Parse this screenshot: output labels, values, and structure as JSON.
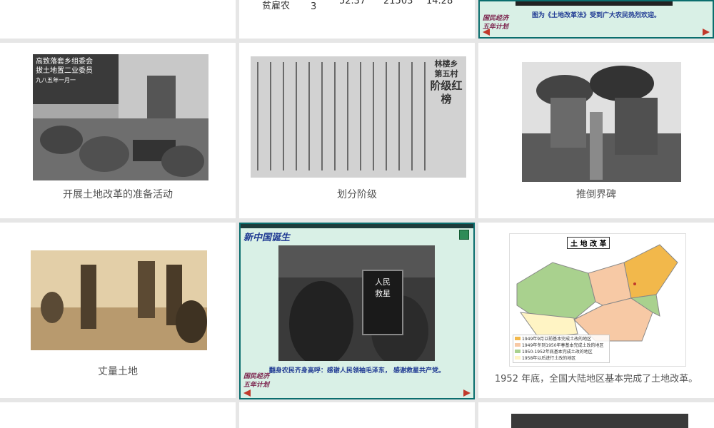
{
  "row0": {
    "table": {
      "label": "贫雇农",
      "sub": "3",
      "c1": "52.37",
      "c2": "21503",
      "c3": "14.28"
    },
    "slide_caption": "图为《土地改革法》受到广大农民热烈欢迎。",
    "nav": [
      "国民经济",
      "五年计划"
    ]
  },
  "row1": [
    {
      "caption": "开展土地改革的准备活动",
      "sign": [
        "高致落套乡组委会",
        "拔土地置二业委员",
        "九八五年一月一"
      ]
    },
    {
      "caption": "划分阶级",
      "banner": [
        "林楼乡",
        "第五村",
        "阶级红榜"
      ]
    },
    {
      "caption": "推倒界碑"
    }
  ],
  "row2": [
    {
      "caption": "丈量土地"
    },
    {
      "title": "新中国诞生",
      "note": "翻身农民齐身高呼：感谢人民领袖毛泽东， 感谢救星共产党。",
      "placard": "人民救星",
      "nav": [
        "国民经济",
        "五年计划"
      ]
    },
    {
      "caption": "1952 年底，全国大陆地区基本完成了土地改革。",
      "map_title": "土 地 改 革",
      "legend": [
        "1949年9月以前基本完成土改的地区",
        "1949年冬到1950年春基本完成土改的地区",
        "1950-1952年底基本完成土改的地区",
        "1958年以后进行土改的地区"
      ],
      "colors": {
        "old": "#f2b84b",
        "early": "#f7c9a5",
        "mid": "#a9d18e",
        "late": "#fff4c4"
      }
    }
  ]
}
